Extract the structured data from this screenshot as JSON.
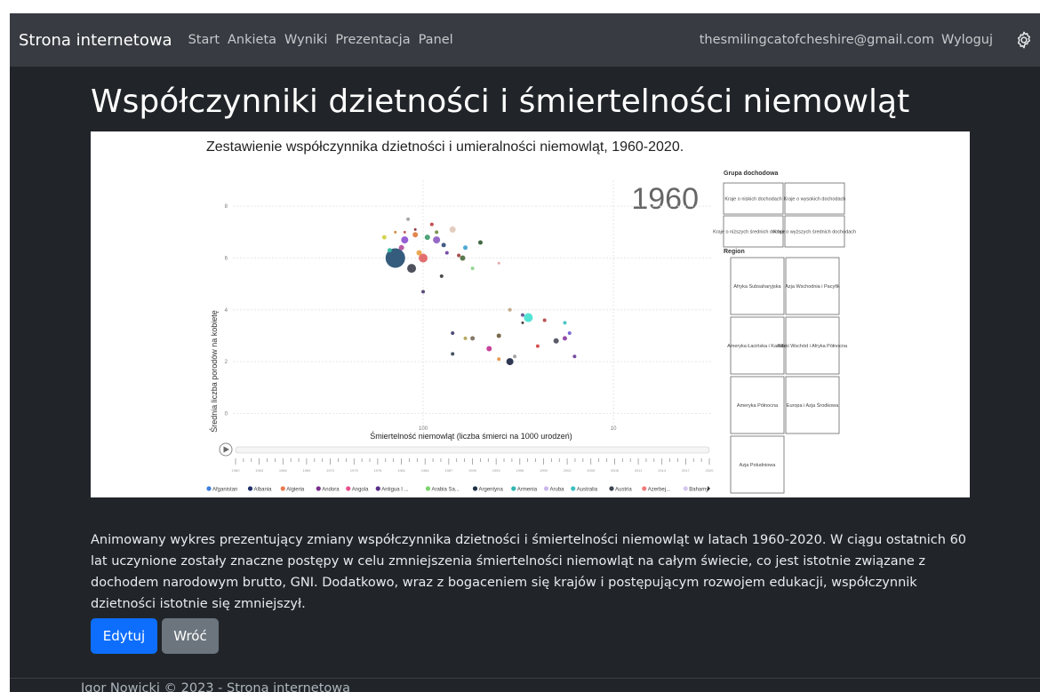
{
  "navbar": {
    "brand": "Strona internetowa",
    "links": [
      "Start",
      "Ankieta",
      "Wyniki",
      "Prezentacja",
      "Panel"
    ],
    "user_email": "thesmilingcatofcheshire@gmail.com",
    "logout": "Wyloguj",
    "settings_icon": "gear-icon"
  },
  "page": {
    "title": "Współczynniki dzietności i śmiertelności niemowląt",
    "description": "Animowany wykres prezentujący zmiany współczynnika dzietności i śmiertelności niemowląt w latach 1960-2020. W ciągu ostatnich 60 lat uczynione zostały znaczne postępy w celu zmniejszenia śmiertelności niemowląt na całym świecie, co jest istotnie związane z dochodem narodowym brutto, GNI. Dodatkowo, wraz z bogaceniem się krajów i postępującym rozwojem edukacji, współczynnik dzietności istotnie się zmniejszył.",
    "edit_button": "Edytuj",
    "back_button": "Wróć"
  },
  "footer": {
    "text": "Igor Nowicki © 2023 - Strona internetowa"
  },
  "chart_data": {
    "type": "scatter",
    "title": "Zestawienie współczynnika dzietności i umieralności niemowląt, 1960-2020.",
    "xlabel": "Śmiertelność niemowląt (liczba śmierci na 1000 urodzeń)",
    "ylabel": "Średnia liczba porodów na kobietę",
    "x_scale": "log, reversed",
    "xlim": [
      1000,
      3
    ],
    "ylim": [
      -0.5,
      9
    ],
    "x_ticks": [
      "100",
      "10"
    ],
    "y_ticks": [
      "0",
      "2",
      "4",
      "6",
      "8"
    ],
    "grid": true,
    "year": "1960",
    "play_icon": "play-icon",
    "timeline_labels": [
      "1960",
      "1963",
      "1966",
      "1969",
      "1972",
      "1975",
      "1978",
      "1981",
      "1984",
      "1987",
      "1990",
      "1993",
      "1996",
      "1999",
      "2002",
      "2005",
      "2008",
      "2011",
      "2014",
      "2017",
      "2020"
    ],
    "legend": [
      {
        "name": "Afganistan",
        "color": "#3f7fe0"
      },
      {
        "name": "Albania",
        "color": "#20306a"
      },
      {
        "name": "Algieria",
        "color": "#e87a4f"
      },
      {
        "name": "Andora",
        "color": "#7a2f8c"
      },
      {
        "name": "Angola",
        "color": "#e84f8c"
      },
      {
        "name": "Antigua I ...",
        "color": "#5a2e8a"
      },
      {
        "name": "Arabia Sa...",
        "color": "#7ad36b"
      },
      {
        "name": "Argentyna",
        "color": "#1f3347"
      },
      {
        "name": "Armenia",
        "color": "#2fb7b0"
      },
      {
        "name": "Aruba",
        "color": "#cbb8ee"
      },
      {
        "name": "Australia",
        "color": "#3fbfbf"
      },
      {
        "name": "Austria",
        "color": "#3c4450"
      },
      {
        "name": "Azerbej...",
        "color": "#f07d7d"
      },
      {
        "name": "Bahamy",
        "color": "#d7c8ee"
      }
    ],
    "income_group_title": "Grupa dochodowa",
    "income_groups": [
      "Kraje o niskich dochodach",
      "Kraje o wysokich dochodach",
      "Kraje o niższych średnich dochodach",
      "Kraje o wyższych średnich dochodach"
    ],
    "region_title": "Region",
    "regions": [
      "Afryka Subsaharyjska",
      "Azja Wschodnia i Pacyfik",
      "Ameryka Łacińska i Karaiby",
      "Bliski Wschód i Afryka Północna",
      "Ameryka Północna",
      "Europa i Azja Środkowa",
      "Azja Południowa"
    ],
    "points": [
      {
        "x": 140,
        "y": 6.0,
        "s": 11,
        "c": "#1f4a6e"
      },
      {
        "x": 100,
        "y": 6.0,
        "s": 5,
        "c": "#e06060"
      },
      {
        "x": 115,
        "y": 5.6,
        "s": 5,
        "c": "#3a3f4a"
      },
      {
        "x": 125,
        "y": 6.7,
        "s": 4,
        "c": "#8a4fd0"
      },
      {
        "x": 85,
        "y": 6.7,
        "s": 4,
        "c": "#8a5ac0"
      },
      {
        "x": 110,
        "y": 6.9,
        "s": 3,
        "c": "#e07a3a"
      },
      {
        "x": 95,
        "y": 6.8,
        "s": 3,
        "c": "#3a9a6a"
      },
      {
        "x": 70,
        "y": 7.1,
        "s": 3.5,
        "c": "#e0c8b8"
      },
      {
        "x": 130,
        "y": 6.4,
        "s": 3,
        "c": "#b04a9a"
      },
      {
        "x": 105,
        "y": 6.2,
        "s": 3,
        "c": "#e8a040"
      },
      {
        "x": 150,
        "y": 6.3,
        "s": 2.5,
        "c": "#2fb7a0"
      },
      {
        "x": 90,
        "y": 7.3,
        "s": 2,
        "c": "#c03a3a"
      },
      {
        "x": 78,
        "y": 6.5,
        "s": 2.5,
        "c": "#2f4a7a"
      },
      {
        "x": 160,
        "y": 6.8,
        "s": 2.5,
        "c": "#d0d040"
      },
      {
        "x": 120,
        "y": 7.5,
        "s": 2,
        "c": "#a0a0a0"
      },
      {
        "x": 62,
        "y": 6.0,
        "s": 3,
        "c": "#4a6a3a"
      },
      {
        "x": 60,
        "y": 6.4,
        "s": 2.5,
        "c": "#3aa0d0"
      },
      {
        "x": 55,
        "y": 5.6,
        "s": 2,
        "c": "#8ad08a"
      },
      {
        "x": 50,
        "y": 6.6,
        "s": 2.5,
        "c": "#305a30"
      },
      {
        "x": 100,
        "y": 4.7,
        "s": 2,
        "c": "#4a3a6a"
      },
      {
        "x": 35,
        "y": 4.0,
        "s": 2,
        "c": "#c0a080"
      },
      {
        "x": 28,
        "y": 3.7,
        "s": 5,
        "c": "#40e0d0"
      },
      {
        "x": 30,
        "y": 3.8,
        "s": 2,
        "c": "#5a4a8a"
      },
      {
        "x": 40,
        "y": 3.0,
        "s": 2.5,
        "c": "#6a5a3a"
      },
      {
        "x": 55,
        "y": 2.9,
        "s": 2.5,
        "c": "#7a6a5a"
      },
      {
        "x": 60,
        "y": 2.9,
        "s": 2,
        "c": "#b0a050"
      },
      {
        "x": 70,
        "y": 3.1,
        "s": 2,
        "c": "#3a3a6a"
      },
      {
        "x": 45,
        "y": 2.5,
        "s": 3,
        "c": "#c03090"
      },
      {
        "x": 70,
        "y": 2.3,
        "s": 2,
        "c": "#304050"
      },
      {
        "x": 35,
        "y": 2.0,
        "s": 4,
        "c": "#1a2440"
      },
      {
        "x": 20,
        "y": 2.8,
        "s": 3,
        "c": "#4a4a5a"
      },
      {
        "x": 18,
        "y": 2.9,
        "s": 2.5,
        "c": "#8a3aa0"
      },
      {
        "x": 23,
        "y": 3.6,
        "s": 2,
        "c": "#b04040"
      },
      {
        "x": 17,
        "y": 3.1,
        "s": 2,
        "c": "#6a5ad0"
      },
      {
        "x": 16,
        "y": 2.2,
        "s": 2,
        "c": "#6a3a9a"
      },
      {
        "x": 25,
        "y": 2.6,
        "s": 2,
        "c": "#d04040"
      },
      {
        "x": 40,
        "y": 2.1,
        "s": 2,
        "c": "#e09040"
      },
      {
        "x": 18,
        "y": 3.5,
        "s": 2,
        "c": "#3ac0c0"
      },
      {
        "x": 33,
        "y": 2.2,
        "s": 2,
        "c": "#9a9a9a"
      },
      {
        "x": 30,
        "y": 3.5,
        "s": 1.5,
        "c": "#303030"
      },
      {
        "x": 65,
        "y": 6.1,
        "s": 2,
        "c": "#a03a3a"
      },
      {
        "x": 85,
        "y": 7.0,
        "s": 2,
        "c": "#6a8a3a"
      },
      {
        "x": 110,
        "y": 7.1,
        "s": 1.5,
        "c": "#8a2a2a"
      },
      {
        "x": 75,
        "y": 6.2,
        "s": 2,
        "c": "#6a3aa0"
      },
      {
        "x": 80,
        "y": 5.3,
        "s": 2,
        "c": "#3a3a3a"
      },
      {
        "x": 125,
        "y": 7.0,
        "s": 1.5,
        "c": "#c05050"
      },
      {
        "x": 140,
        "y": 7.0,
        "s": 1.5,
        "c": "#d08030"
      },
      {
        "x": 40,
        "y": 5.8,
        "s": 1.5,
        "c": "#e0a0a0"
      }
    ]
  }
}
